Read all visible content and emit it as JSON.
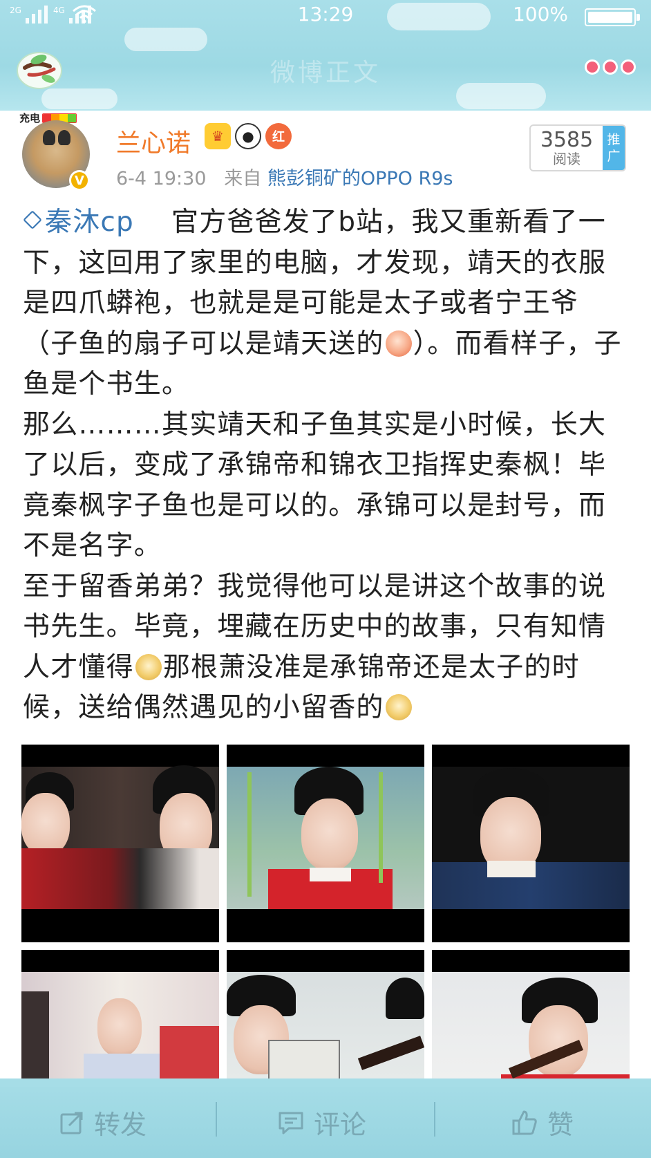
{
  "status_bar": {
    "network_1": "2G",
    "network_2": "4G",
    "time": "13:29",
    "battery_percent": "100%",
    "battery_level": 1.0
  },
  "header": {
    "title": "微博正文",
    "back_icon": "branch-back-icon",
    "more_icon": "three-dots-icon"
  },
  "post": {
    "charge_badge": "充电",
    "username": "兰心诺",
    "badge_icons": [
      "crown-icon",
      "panda-icon",
      "red-badge-icon"
    ],
    "badge_red_label": "红",
    "verified_mark": "V",
    "time": "6-4 19:30",
    "from_label": "来自",
    "source": "熊彭铜矿的OPPO R9s",
    "reads": "3585",
    "reads_label": "阅读",
    "promo_label_1": "推",
    "promo_label_2": "广",
    "topic": "秦沐cp",
    "paragraphs": {
      "p1_a": "官方爸爸发了b站，我又重新看了一下，这回用了家里的电脑，才发现，靖天的衣服是四爪蟒袍，也就是是可能是太子或者宁王爷（子鱼的扇子可以是靖天送的",
      "p1_b": "）。而看样子，子鱼是个书生。",
      "p2": "那么………其实靖天和子鱼其实是小时候，长大了以后，变成了承锦帝和锦衣卫指挥史秦枫！毕竟秦枫字子鱼也是可以的。承锦可以是封号，而不是名字。",
      "p3_a": "至于留香弟弟？我觉得他可以是讲这个故事的说书先生。毕竟，埋藏在历史中的故事，只有知情人才懂得",
      "p3_b": "那根萧没准是承锦帝还是太子的时候，送给偶然遇见的小留香的"
    }
  },
  "bottom_bar": {
    "repost": "转发",
    "comment": "评论",
    "like": "赞"
  },
  "colors": {
    "accent_blue": "#3a78b5",
    "username_orange": "#f07a2a",
    "bar_teal": "#a6dde7"
  }
}
